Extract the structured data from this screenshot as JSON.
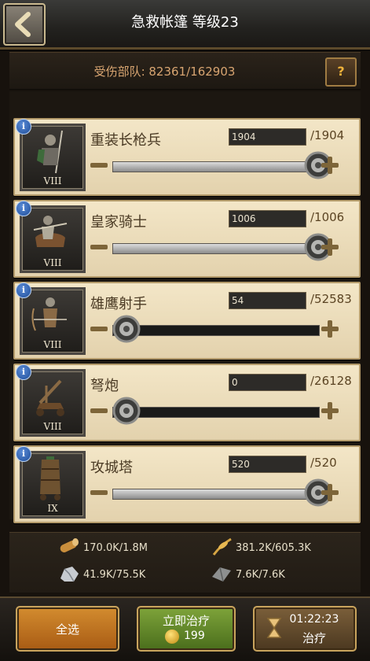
{
  "header": {
    "title": "急救帐篷 等级23"
  },
  "injured": {
    "label": "受伤部队: 82361/162903",
    "help": "?"
  },
  "units": [
    {
      "name": "重装长枪兵",
      "rank": "VIII",
      "count": "1904",
      "max": "/1904",
      "selected_fraction": 1.0
    },
    {
      "name": "皇家骑士",
      "rank": "VIII",
      "count": "1006",
      "max": "/1006",
      "selected_fraction": 1.0
    },
    {
      "name": "雄鹰射手",
      "rank": "VIII",
      "count": "54",
      "max": "/52583",
      "selected_fraction": 0.001
    },
    {
      "name": "弩炮",
      "rank": "VIII",
      "count": "0",
      "max": "/26128",
      "selected_fraction": 0.0
    },
    {
      "name": "攻城塔",
      "rank": "IX",
      "count": "520",
      "max": "/520",
      "selected_fraction": 1.0
    }
  ],
  "resources": {
    "wood": "170.0K/1.8M",
    "food": "381.2K/605.3K",
    "stone": "41.9K/75.5K",
    "iron": "7.6K/7.6K"
  },
  "buttons": {
    "select_all": "全选",
    "instant_heal": "立即治疗",
    "instant_cost": "199",
    "heal_time": "01:22:23",
    "heal": "治疗"
  },
  "colors": {
    "accent_gold": "#c9a45d",
    "card_bg": "#f3e6c7"
  }
}
